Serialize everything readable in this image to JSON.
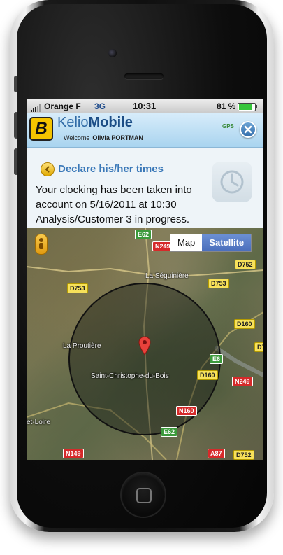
{
  "status_bar": {
    "carrier": "Orange F",
    "network": "3G",
    "time": "10:31",
    "battery_percent": "81 %",
    "battery_level": 0.81
  },
  "app": {
    "title_light": "Kelio",
    "title_bold": "Mobile",
    "logo_letter": "B",
    "welcome_label": "Welcome",
    "user_name": "Olivia PORTMAN",
    "gps_label": "GPS"
  },
  "content": {
    "declare_link": "Declare his/her times",
    "message_lines": [
      "Your clocking has been taken into",
      "account on 5/16/2011 at 10:30",
      "Analysis/Customer 3 in progress."
    ]
  },
  "map": {
    "type_buttons": {
      "map": "Map",
      "satellite": "Satellite"
    },
    "selected_type": "Satellite",
    "places": [
      "La Séguinière",
      "La Proutière",
      "Saint-Christophe-du-Bois",
      "et-Loire"
    ],
    "roads": [
      "E62",
      "N249",
      "D752",
      "D753",
      "D753",
      "D160",
      "D7",
      "E6",
      "D160",
      "N249",
      "N160",
      "E62",
      "N149",
      "A87",
      "D752"
    ]
  },
  "colors": {
    "accent": "#3a78b8",
    "header_top": "#d7ecfa",
    "header_bottom": "#a9d4ef",
    "logo_yellow": "#f5c400",
    "satellite_btn": "#4a6ebc"
  }
}
